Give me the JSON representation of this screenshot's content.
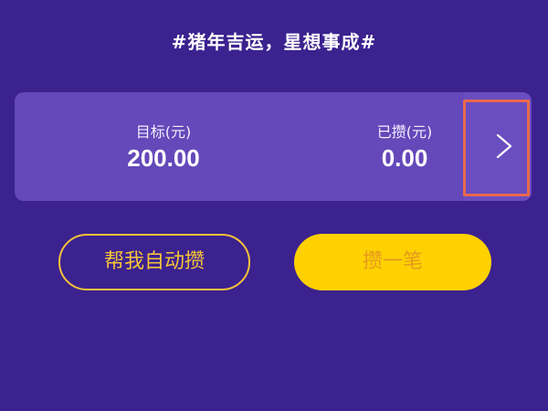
{
  "header": {
    "slogan": "#猪年吉运，星想事成#"
  },
  "card": {
    "target_label": "目标(元)",
    "target_value": "200.00",
    "saved_label": "已攒(元)",
    "saved_value": "0.00",
    "next_icon": "chevron-right-icon"
  },
  "actions": {
    "auto_save_label": "帮我自动攒",
    "save_once_label": "攒一笔"
  },
  "colors": {
    "background": "#3b228f",
    "card": "#6548b9",
    "accent_yellow": "#ffd100",
    "outline_gold": "#f5c23a",
    "highlight": "#e8694f"
  }
}
